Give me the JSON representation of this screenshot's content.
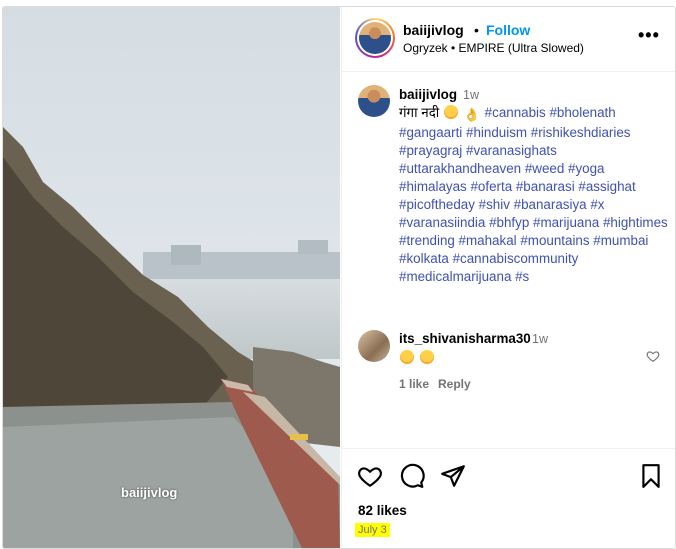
{
  "post": {
    "watermark": "baiijivlog"
  },
  "header": {
    "username": "baiijivlog",
    "separator": "•",
    "follow_label": "Follow",
    "audio": "Ogryzek • EMPIRE (Ultra Slowed)",
    "more_label": "•••"
  },
  "caption": {
    "username": "baiijivlog",
    "time": "1w",
    "text_before": "गंगा नदी",
    "hashtags": "#cannabis #bholenath #gangaarti #hinduism #rishikeshdiaries #prayagraj #varanasighats #uttarakhandheaven #weed #yoga #himalayas #oferta #banarasi #assighat #picoftheday #shiv #banarasiya #x #varanasiindia #bhfyp #marijuana #hightimes #trending #mahakal #mountains #mumbai #kolkata #cannabiscommunity #medicalmarijuana #s"
  },
  "comment": {
    "username": "its_shivanisharma30",
    "time": "1w",
    "likes": "1 like",
    "reply_label": "Reply"
  },
  "footer": {
    "likes": "82 likes",
    "date": "July 3"
  },
  "icons": [
    "heart-icon",
    "comment-icon",
    "share-icon",
    "bookmark-icon",
    "more-icon"
  ]
}
